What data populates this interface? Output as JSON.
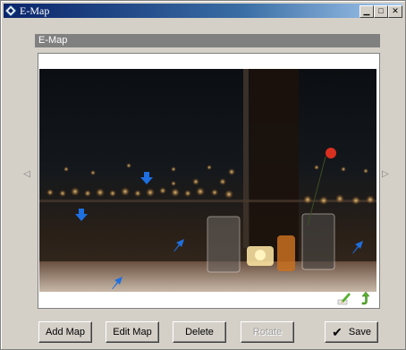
{
  "window": {
    "title": "E-Map"
  },
  "section": {
    "header": "E-Map"
  },
  "buttons": {
    "add_map": "Add Map",
    "edit_map": "Edit Map",
    "delete": "Delete",
    "rotate": "Rotate",
    "save": "Save"
  },
  "markers": [
    {
      "type": "camera-marker",
      "direction": "down"
    },
    {
      "type": "camera-marker",
      "direction": "down"
    },
    {
      "type": "camera-marker",
      "direction": "up-right"
    },
    {
      "type": "camera-marker",
      "direction": "up-right"
    },
    {
      "type": "camera-marker",
      "direction": "up-right"
    }
  ],
  "icons": {
    "edit": "pencil-icon",
    "undo": "undo-arrow-icon",
    "prev": "left-triangle-icon",
    "next": "right-triangle-icon",
    "save": "checkmark-icon"
  },
  "colors": {
    "title_start": "#0a246a",
    "title_end": "#a6caf0",
    "marker": "#1e6fe0",
    "header": "#808080"
  }
}
